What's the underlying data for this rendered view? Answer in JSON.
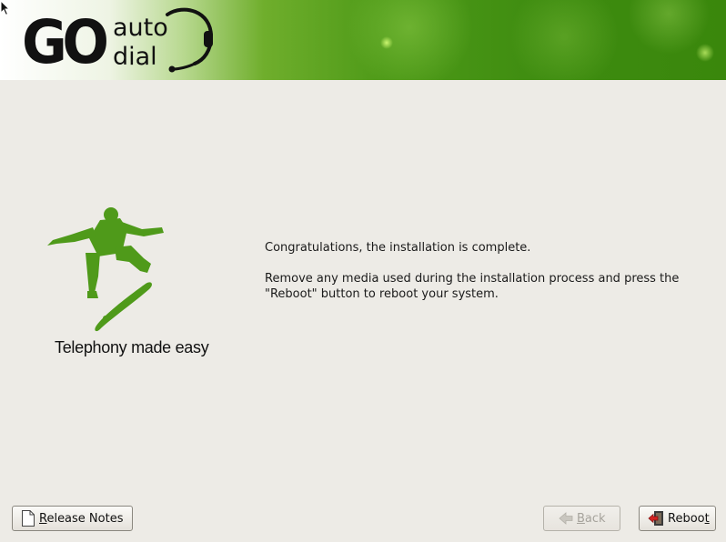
{
  "header": {
    "logo": {
      "go": "GO",
      "auto": "auto",
      "dial": "dial"
    }
  },
  "branding": {
    "tagline": "Telephony made easy",
    "accent_color": "#4f9a1a"
  },
  "message": {
    "line1": "Congratulations, the installation is complete.",
    "line2": "Remove any media used during the installation process and press the \"Reboot\" button to reboot your system."
  },
  "buttons": {
    "release_notes": {
      "mnemonic": "R",
      "rest": "elease Notes"
    },
    "back": {
      "mnemonic": "B",
      "rest": "ack",
      "enabled": false
    },
    "reboot": {
      "pre": "Reboo",
      "mnemonic": "t"
    }
  }
}
